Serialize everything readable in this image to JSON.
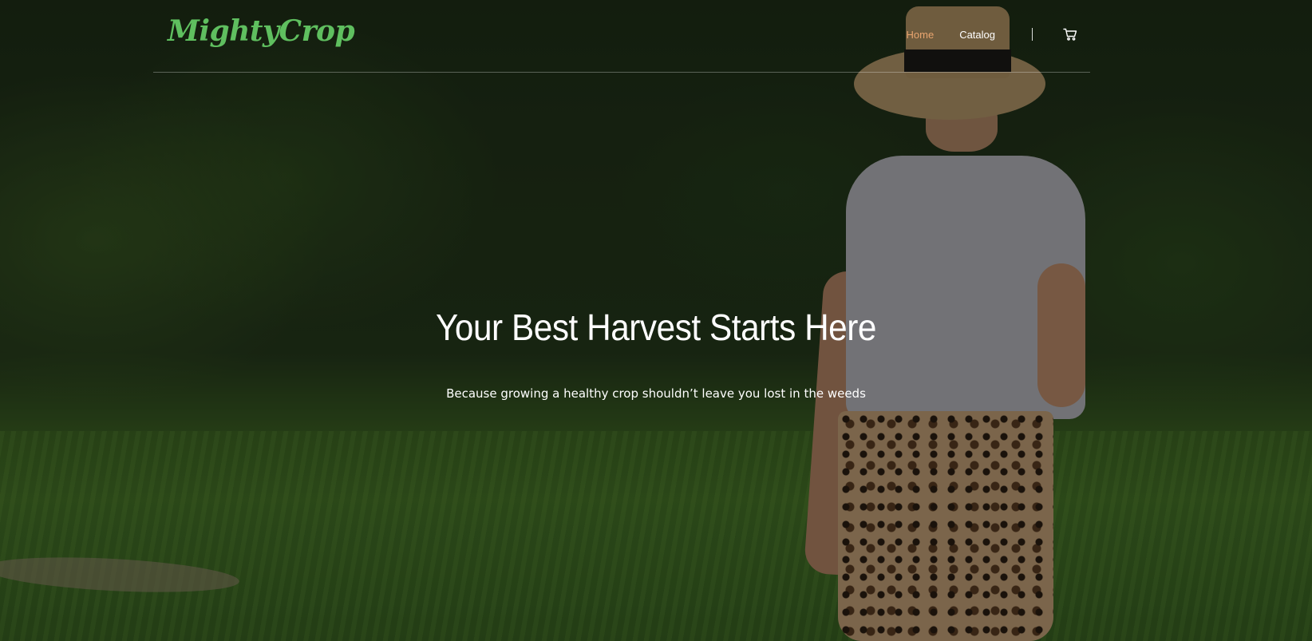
{
  "brand": {
    "logo_text": "MightyCrop"
  },
  "nav": {
    "items": [
      {
        "label": "Home",
        "active": true
      },
      {
        "label": "Catalog",
        "active": false
      }
    ],
    "cart_icon": "cart-icon"
  },
  "hero": {
    "title": "Your Best Harvest Starts Here",
    "subtitle": "Because growing a healthy crop shouldn’t leave you lost in the weeds"
  },
  "colors": {
    "logo": "#5fbf5f",
    "nav_active": "#e9a56f",
    "text": "#ffffff"
  }
}
